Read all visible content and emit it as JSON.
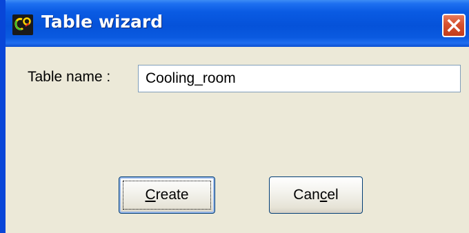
{
  "window": {
    "title": "Table wizard",
    "app_icon": "sigma-chart-app-icon",
    "close_icon": "close-x-icon"
  },
  "form": {
    "table_name_label": "Table name :",
    "table_name_value": "Cooling_room"
  },
  "buttons": {
    "create": {
      "before": "",
      "mnemonic": "C",
      "after": "reate"
    },
    "cancel": {
      "before": "Can",
      "mnemonic": "c",
      "after": "el"
    }
  },
  "colors": {
    "titlebar": "#0552d9",
    "dialog_bg": "#ece9d8",
    "close_button": "#d5512f",
    "input_border": "#7f9db9"
  }
}
